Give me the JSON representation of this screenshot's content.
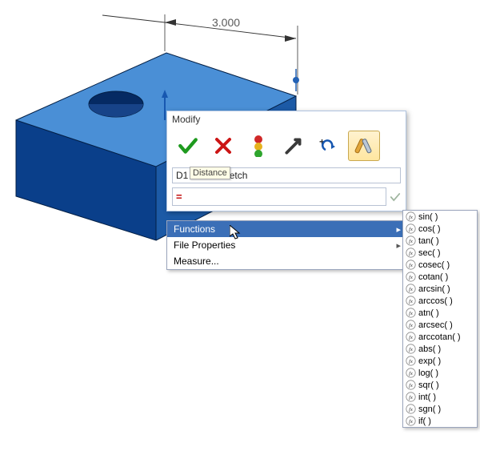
{
  "dimension": {
    "value": "3.000"
  },
  "dialog": {
    "title": "Modify",
    "name_label": "D1   base sketch",
    "tooltip": "Distance",
    "expression": "=",
    "buttons": {
      "accept": "Accept",
      "cancel": "Cancel",
      "traffic": "Tolerance",
      "link": "Link",
      "update": "Update",
      "measure": "Measure"
    }
  },
  "dropdown": {
    "items": [
      {
        "label": "Functions",
        "has_sub": true,
        "selected": true
      },
      {
        "label": "File Properties",
        "has_sub": true,
        "selected": false
      },
      {
        "label": "Measure...",
        "has_sub": false,
        "selected": false
      }
    ]
  },
  "functions": [
    "sin( )",
    "cos( )",
    "tan( )",
    "sec( )",
    "cosec( )",
    "cotan( )",
    "arcsin( )",
    "arccos( )",
    "atn( )",
    "arcsec( )",
    "arccotan( )",
    "abs( )",
    "exp( )",
    "log( )",
    "sqr( )",
    "int( )",
    "sgn( )",
    "if( )"
  ],
  "colors": {
    "accent": "#3b6fb7",
    "solid_top": "#4a8fd6",
    "solid_left": "#0a3f8a",
    "solid_right": "#1c5aa6"
  }
}
